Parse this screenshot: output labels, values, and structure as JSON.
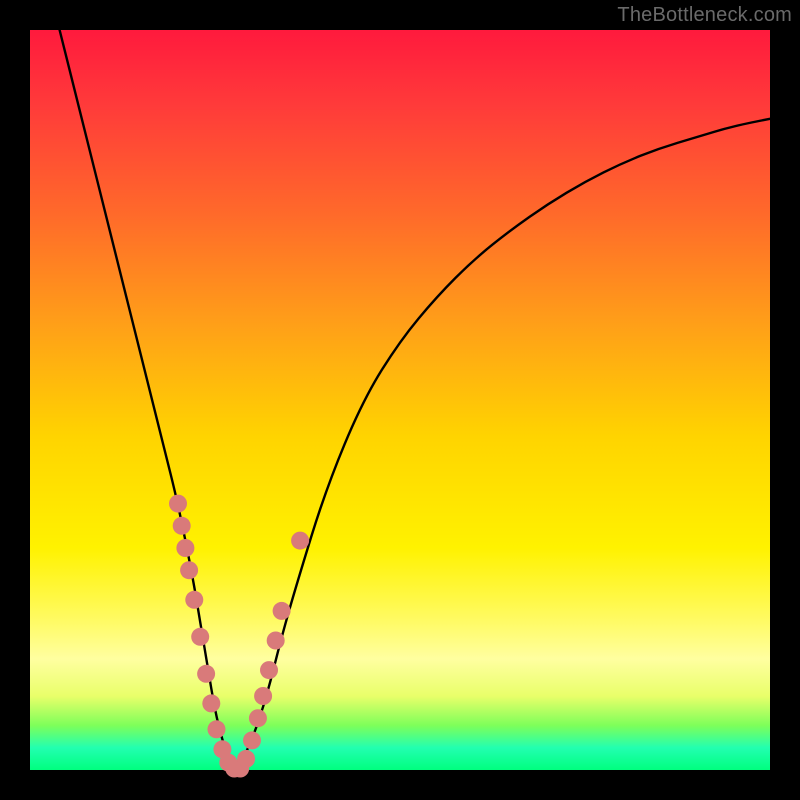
{
  "watermark": {
    "text": "TheBottleneck.com"
  },
  "colors": {
    "curve": "#000000",
    "marker_fill": "#d97a7a",
    "marker_stroke": "#a85a5a"
  },
  "chart_data": {
    "type": "line",
    "title": "",
    "xlabel": "",
    "ylabel": "",
    "xlim": [
      0,
      100
    ],
    "ylim": [
      0,
      100
    ],
    "grid": false,
    "legend": false,
    "series": [
      {
        "name": "bottleneck-curve",
        "x": [
          4,
          6,
          8,
          10,
          12,
          14,
          16,
          18,
          20,
          22,
          23,
          24,
          25,
          26,
          27,
          28,
          30,
          32,
          34,
          36,
          40,
          45,
          50,
          55,
          60,
          65,
          70,
          75,
          80,
          85,
          90,
          95,
          100
        ],
        "y": [
          100,
          92,
          84,
          76,
          68,
          60,
          52,
          44,
          36,
          26,
          20,
          14,
          8,
          4,
          1,
          0,
          4,
          10,
          18,
          25,
          38,
          50,
          58,
          64,
          69,
          73,
          76.5,
          79.5,
          82,
          84,
          85.5,
          87,
          88
        ]
      }
    ],
    "markers": [
      {
        "x": 20.0,
        "y": 36
      },
      {
        "x": 20.5,
        "y": 33
      },
      {
        "x": 21.0,
        "y": 30
      },
      {
        "x": 21.5,
        "y": 27
      },
      {
        "x": 22.2,
        "y": 23
      },
      {
        "x": 23.0,
        "y": 18
      },
      {
        "x": 23.8,
        "y": 13
      },
      {
        "x": 24.5,
        "y": 9
      },
      {
        "x": 25.2,
        "y": 5.5
      },
      {
        "x": 26.0,
        "y": 2.8
      },
      {
        "x": 26.8,
        "y": 1.0
      },
      {
        "x": 27.6,
        "y": 0.2
      },
      {
        "x": 28.4,
        "y": 0.2
      },
      {
        "x": 29.2,
        "y": 1.5
      },
      {
        "x": 30.0,
        "y": 4.0
      },
      {
        "x": 30.8,
        "y": 7.0
      },
      {
        "x": 31.5,
        "y": 10.0
      },
      {
        "x": 32.3,
        "y": 13.5
      },
      {
        "x": 33.2,
        "y": 17.5
      },
      {
        "x": 34.0,
        "y": 21.5
      },
      {
        "x": 36.5,
        "y": 31.0
      }
    ],
    "marker_radius_px": 9
  }
}
